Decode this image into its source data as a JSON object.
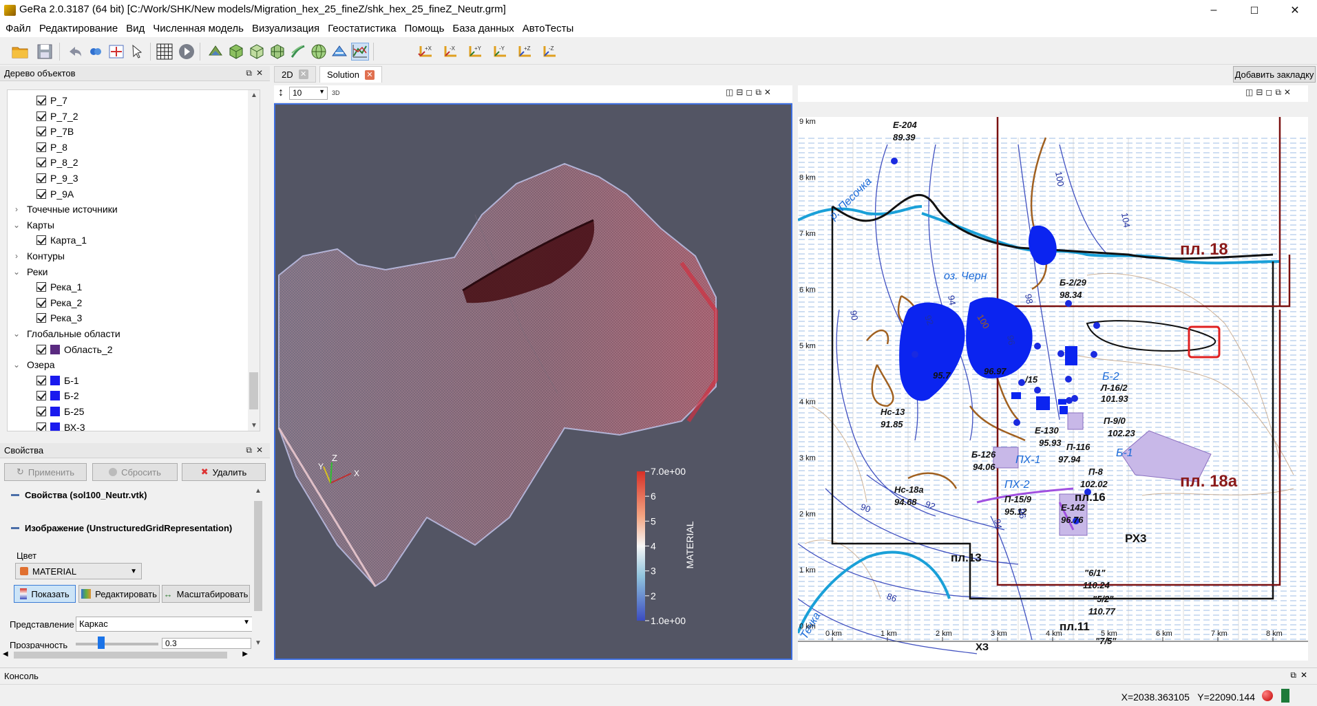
{
  "window": {
    "title": "GeRa 2.0.3187 (64 bit)   [C:/Work/SHK/New models/Migration_hex_25_fineZ/shk_hex_25_fineZ_Neutr.grm]",
    "minimize": "–",
    "maximize": "☐",
    "close": "✕"
  },
  "menu": [
    "Файл",
    "Редактирование",
    "Вид",
    "Численная модель",
    "Визуализация",
    "Геостатистика",
    "Помощь",
    "База данных",
    "АвтоТесты"
  ],
  "toolbar": {
    "axis_labels": [
      "+X",
      "-X",
      "+Y",
      "-Y",
      "+Z",
      "-Z"
    ]
  },
  "object_tree": {
    "title": "Дерево объектов",
    "rows": [
      {
        "type": "check",
        "label": "P_7",
        "indent": 2
      },
      {
        "type": "check",
        "label": "P_7_2",
        "indent": 2
      },
      {
        "type": "check",
        "label": "P_7B",
        "indent": 2
      },
      {
        "type": "check",
        "label": "P_8",
        "indent": 2
      },
      {
        "type": "check",
        "label": "P_8_2",
        "indent": 2
      },
      {
        "type": "check",
        "label": "P_9_3",
        "indent": 2
      },
      {
        "type": "check",
        "label": "P_9A",
        "indent": 2
      },
      {
        "type": "group",
        "label": "Точечные источники",
        "expanded": false
      },
      {
        "type": "group",
        "label": "Карты",
        "expanded": true
      },
      {
        "type": "check",
        "label": "Карта_1",
        "indent": 2
      },
      {
        "type": "group",
        "label": "Контуры",
        "expanded": false
      },
      {
        "type": "group",
        "label": "Реки",
        "expanded": true
      },
      {
        "type": "check",
        "label": "Река_1",
        "indent": 2
      },
      {
        "type": "check",
        "label": "Река_2",
        "indent": 2
      },
      {
        "type": "check",
        "label": "Река_3",
        "indent": 2
      },
      {
        "type": "group",
        "label": "Глобальные области",
        "expanded": true
      },
      {
        "type": "check",
        "label": "Область_2",
        "indent": 2,
        "color": "#5a2a80"
      },
      {
        "type": "group",
        "label": "Озера",
        "expanded": true
      },
      {
        "type": "check",
        "label": "Б-1",
        "indent": 2,
        "color": "#1a1aee"
      },
      {
        "type": "check",
        "label": "Б-2",
        "indent": 2,
        "color": "#1a1aee"
      },
      {
        "type": "check",
        "label": "Б-25",
        "indent": 2,
        "color": "#1a1aee"
      },
      {
        "type": "check",
        "label": "ВХ-3",
        "indent": 2,
        "color": "#1a1aee"
      }
    ]
  },
  "properties": {
    "title": "Свойства",
    "apply": "Применить",
    "reset": "Сбросить",
    "delete": "Удалить",
    "section1": "Свойства (sol100_Neutr.vtk)",
    "section2": "Изображение (UnstructuredGridRepresentation)",
    "color_label": "Цвет",
    "color_value": "MATERIAL",
    "show": "Показать",
    "edit": "Редактировать",
    "scale": "Масштабировать",
    "representation_label": "Представление",
    "representation_value": "Каркас",
    "opacity_label": "Прозрачность",
    "opacity_value": "0.3"
  },
  "tabs": {
    "tab_2d": "2D",
    "tab_solution": "Solution",
    "add_bookmark": "Добавить закладку",
    "zscale_value": "10",
    "mode_3d": "3D"
  },
  "colorbar": {
    "title": "MATERIAL",
    "ticks": [
      "7.0e+00",
      "6",
      "5",
      "4",
      "3",
      "2",
      "1.0e+00"
    ],
    "colors": [
      "#d73027",
      "#f4a582",
      "#f7f7f7",
      "#92c5de",
      "#3b4cc0"
    ]
  },
  "axes_triad": {
    "x": "X",
    "y": "Y",
    "z": "Z"
  },
  "map": {
    "y_axis": [
      "9 km",
      "8 km",
      "7 km",
      "6 km",
      "5 km",
      "4 km",
      "3 km",
      "2 km",
      "1 km",
      "0 km"
    ],
    "x_axis": [
      "0 km",
      "1 km",
      "2 km",
      "3 km",
      "4 km",
      "5 km",
      "6 km",
      "7 km",
      "8 km"
    ],
    "wells": [
      {
        "name": "Е-204",
        "value": "89.39"
      },
      {
        "name": "Б-2/29",
        "value": "98.34"
      },
      {
        "name": "Нс-13",
        "value": "91.85"
      },
      {
        "name": "Нс-18а",
        "value": "94.68"
      },
      {
        "name": "Е-130",
        "value": "95.93"
      },
      {
        "name": "П-116",
        "value": "97.94"
      },
      {
        "name": "П-8",
        "value": "102.02"
      },
      {
        "name": "П-15/9",
        "value": "95.12"
      },
      {
        "name": "Е-142",
        "value": "96.76"
      },
      {
        "name": "\"6/1\"",
        "value": "110.24"
      },
      {
        "name": "\"5/2\"",
        "value": "110.77"
      },
      {
        "name": "Л-16/2",
        "value": "101.93"
      },
      {
        "name": "П-9/0",
        "value": "102.23"
      },
      {
        "name": "Б-126",
        "value": "94.06"
      }
    ],
    "labels": {
      "pl18": "пл. 18",
      "pl18a": "пл. 18а",
      "pl16": "пл.16",
      "pl13": "пл.13",
      "pl11": "пл.11",
      "rh3": "РХ3",
      "lake": "оз. Черн",
      "river": "р. Песочка",
      "river2": "Течка",
      "b2": "Б-2",
      "b1": "Б-1",
      "px1": "ПХ-1",
      "px2": "ПХ-2",
      "x": "ХЗ",
      "v1": "95.7",
      "v2": "96.97",
      "v3": "/15",
      "v4": "\"7/5\""
    },
    "contours": [
      "100",
      "104",
      "98",
      "94",
      "92",
      "96",
      "100",
      "90",
      "92",
      "90",
      "94",
      "96",
      "86"
    ]
  },
  "console": {
    "title": "Консоль"
  },
  "status": {
    "x": "X=2038.363105",
    "y": "Y=22090.144"
  }
}
